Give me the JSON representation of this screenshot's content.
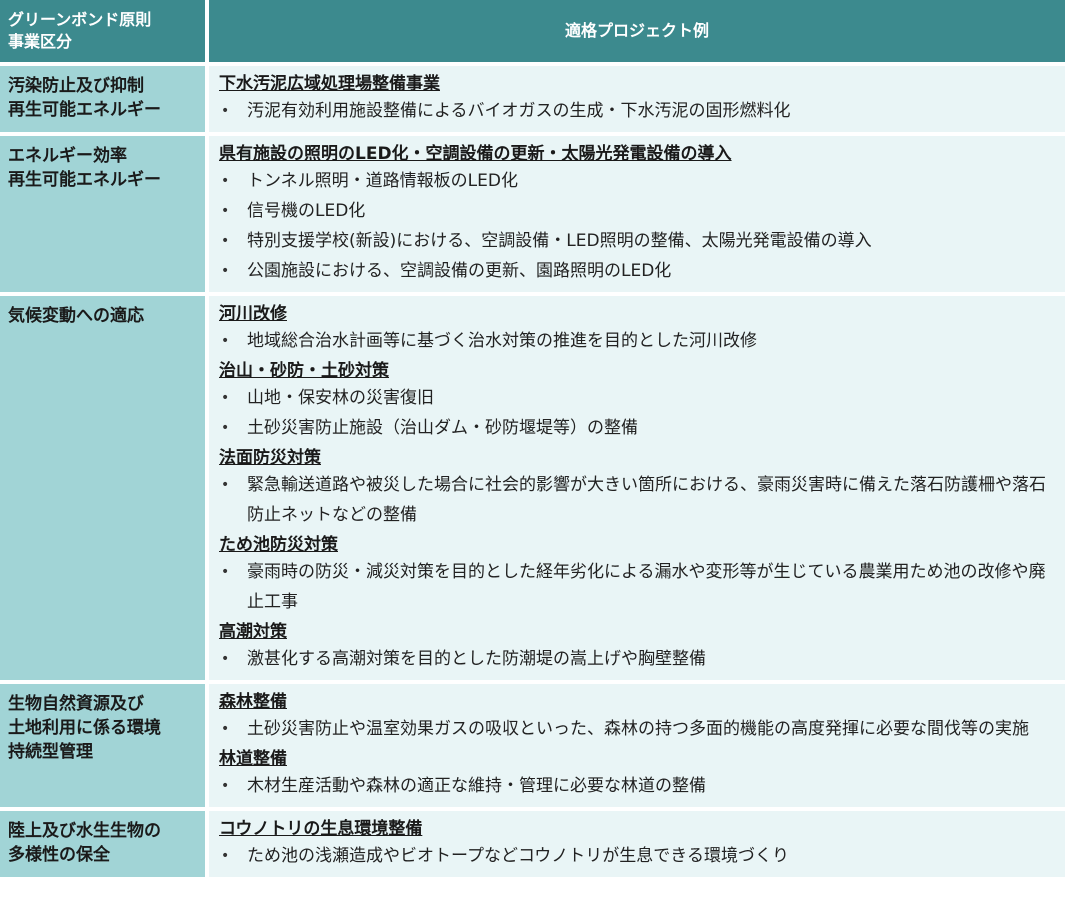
{
  "header": {
    "col1_line1": "グリーンボンド原則",
    "col1_line2": "事業区分",
    "col2": "適格プロジェクト例"
  },
  "rows": [
    {
      "category_lines": [
        "汚染防止及び抑制",
        "再生可能エネルギー"
      ],
      "projects": [
        {
          "title": "下水汚泥広域処理場整備事業",
          "items": [
            "汚泥有効利用施設整備によるバイオガスの生成・下水汚泥の固形燃料化"
          ]
        }
      ]
    },
    {
      "category_lines": [
        "エネルギー効率",
        "再生可能エネルギー"
      ],
      "projects": [
        {
          "title": "県有施設の照明のLED化・空調設備の更新・太陽光発電設備の導入",
          "items": [
            "トンネル照明・道路情報板のLED化",
            "信号機のLED化",
            "特別支援学校(新設)における、空調設備・LED照明の整備、太陽光発電設備の導入",
            "公園施設における、空調設備の更新、園路照明のLED化"
          ]
        }
      ]
    },
    {
      "category_lines": [
        "気候変動への適応"
      ],
      "projects": [
        {
          "title": "河川改修",
          "items": [
            "地域総合治水計画等に基づく治水対策の推進を目的とした河川改修"
          ]
        },
        {
          "title": "治山・砂防・土砂対策",
          "items": [
            "山地・保安林の災害復旧",
            "土砂災害防止施設（治山ダム・砂防堰堤等）の整備"
          ]
        },
        {
          "title": "法面防災対策",
          "items": [
            "緊急輸送道路や被災した場合に社会的影響が大きい箇所における、豪雨災害時に備えた落石防護柵や落石防止ネットなどの整備"
          ]
        },
        {
          "title": "ため池防災対策",
          "items": [
            "豪雨時の防災・減災対策を目的とした経年劣化による漏水や変形等が生じている農業用ため池の改修や廃止工事"
          ]
        },
        {
          "title": "高潮対策",
          "items": [
            "激甚化する高潮対策を目的とした防潮堤の嵩上げや胸壁整備"
          ]
        }
      ]
    },
    {
      "category_lines": [
        "生物自然資源及び",
        "土地利用に係る環境",
        "持続型管理"
      ],
      "projects": [
        {
          "title": "森林整備",
          "items": [
            "土砂災害防止や温室効果ガスの吸収といった、森林の持つ多面的機能の高度発揮に必要な間伐等の実施"
          ]
        },
        {
          "title": "林道整備",
          "items": [
            "木材生産活動や森林の適正な維持・管理に必要な林道の整備"
          ]
        }
      ]
    },
    {
      "category_lines": [
        "陸上及び水生生物の",
        "多様性の保全"
      ],
      "projects": [
        {
          "title": "コウノトリの生息環境整備",
          "items": [
            "ため池の浅瀬造成やビオトープなどコウノトリが生息できる環境づくり"
          ]
        }
      ]
    }
  ]
}
